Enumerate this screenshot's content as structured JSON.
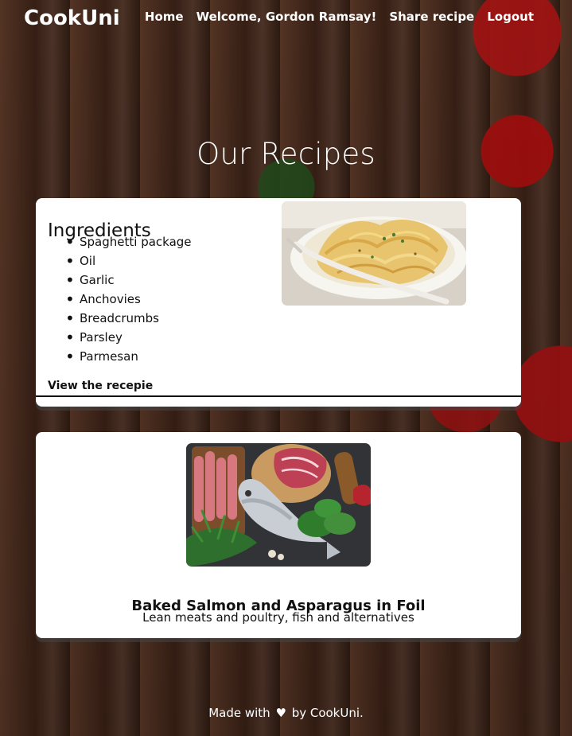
{
  "header": {
    "brand": "CookUni",
    "nav": [
      {
        "label": "Home"
      },
      {
        "label": "Welcome, Gordon Ramsay!"
      },
      {
        "label": "Share recipe"
      },
      {
        "label": "Logout"
      }
    ]
  },
  "page": {
    "title": "Our Recipes"
  },
  "recipe_card": {
    "ingredients_title": "Ingredients",
    "ingredients": [
      "Spaghetti package",
      "Oil",
      "Garlic",
      "Anchovies",
      "Breadcrumbs",
      "Parsley",
      "Parmesan"
    ],
    "view_link": "View the recepie",
    "image_icon": "spaghetti-photo"
  },
  "recipe_preview": {
    "title": "Baked Salmon and Asparagus in Foil",
    "category": "Lean meats and poultry, fish and alternatives",
    "image_icon": "salmon-ingredients-photo"
  },
  "footer": {
    "prefix": "Made with",
    "icon": "heart-icon",
    "suffix": "by CookUni."
  }
}
